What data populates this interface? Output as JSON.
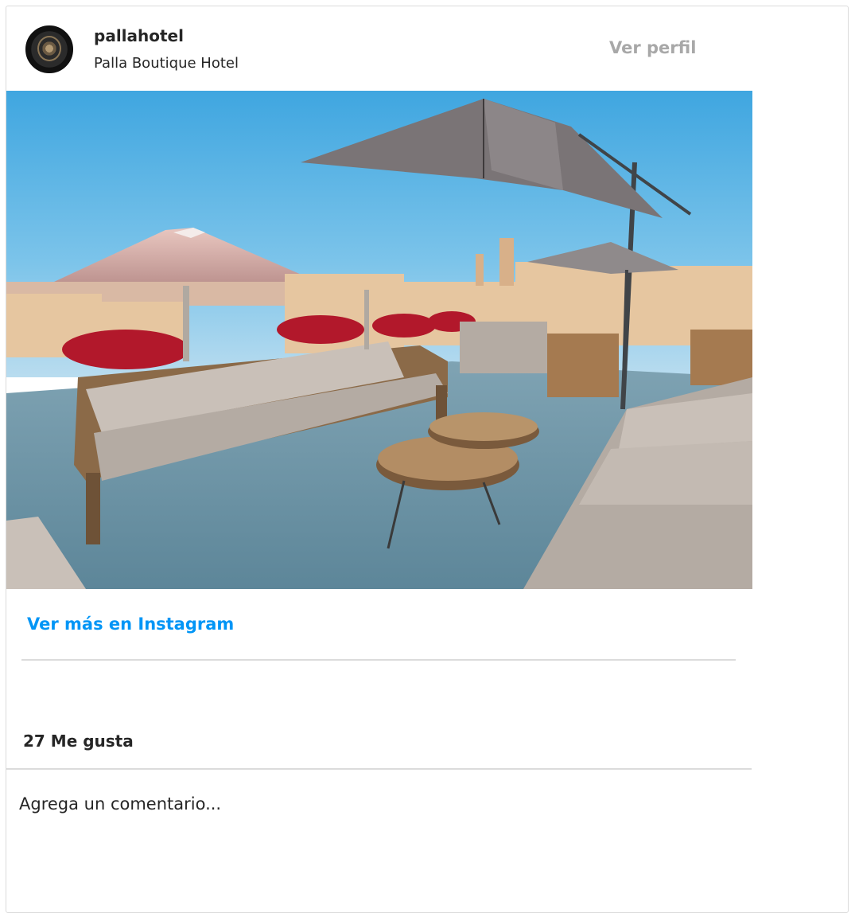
{
  "post": {
    "username": "pallahotel",
    "full_name": "Palla Boutique Hotel",
    "view_profile_label": "Ver perfil",
    "more_link_label": "Ver más en Instagram",
    "likes_text": "27 Me gusta",
    "comment_placeholder": "Agrega un comentario..."
  },
  "colors": {
    "link_blue": "#0095f6",
    "muted_gray": "#a8a8a8",
    "text": "#262626",
    "divider": "#dbdbdb"
  },
  "icons": {
    "avatar": "hotel-emblem-avatar"
  }
}
